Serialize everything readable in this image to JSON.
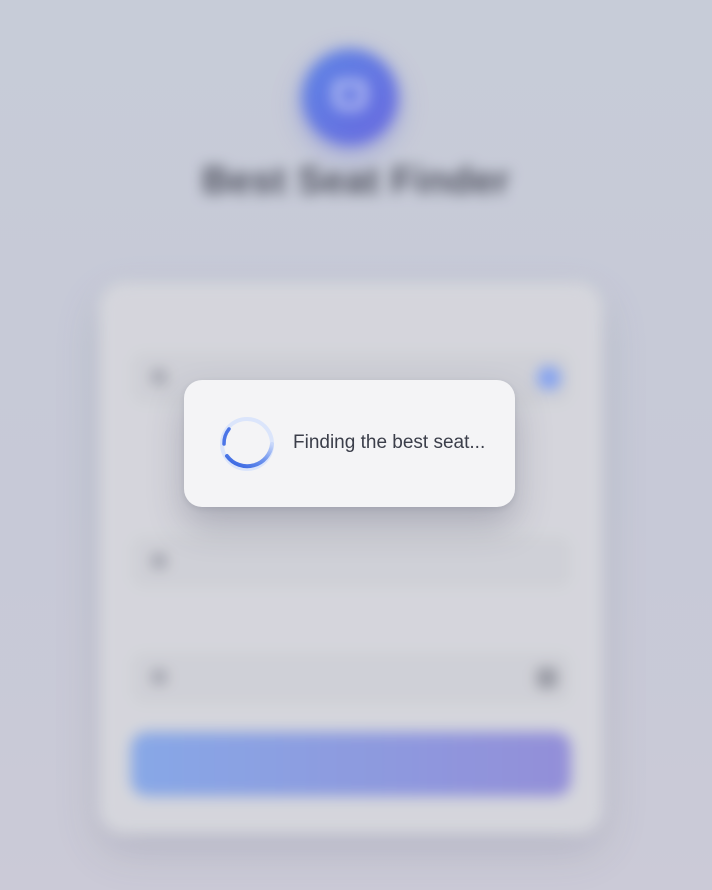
{
  "app": {
    "title": "Best Seat Finder",
    "subtitle": ""
  },
  "form": {
    "fields": [
      {
        "label": "",
        "value": ""
      },
      {
        "label": "",
        "value": ""
      },
      {
        "label": "",
        "value": ""
      }
    ],
    "find_button_label": ""
  },
  "loading": {
    "message": "Finding the best seat..."
  },
  "colors": {
    "accent_start": "#4f7be6",
    "accent_end": "#5b5be0",
    "button_gradient_start": "#7ea3e8",
    "button_gradient_end": "#8b86d8",
    "dialog_background": "#f4f4f6",
    "spinner": "#3f6fe8"
  },
  "icons": {
    "logo": "seat-icon",
    "spinner": "loading-spinner-icon",
    "field_1": "location-icon",
    "field_2": "location-icon",
    "field_3": "clock-icon",
    "field_1_action": "locate-icon",
    "field_3_action": "calendar-icon"
  }
}
